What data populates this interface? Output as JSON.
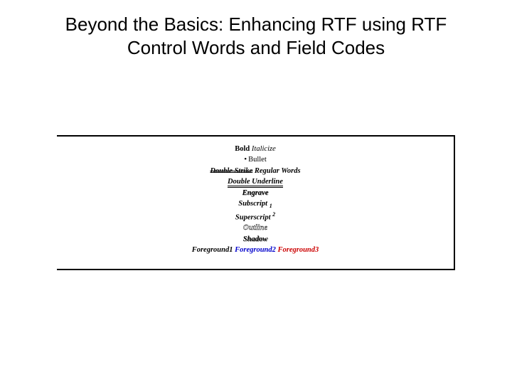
{
  "title": "Beyond the Basics: Enhancing RTF using RTF Control Words and Field Codes",
  "sample": {
    "bold": "Bold",
    "italicize": "Italicize",
    "bullet": "Bullet",
    "double_strike": "Double Strike",
    "regular_words": "Regular Words",
    "double_underline": "Double Underline",
    "engrave": "Engrave",
    "subscript_label": "Subscript",
    "subscript_value": "1",
    "superscript_label": "Superscript",
    "superscript_value": "2",
    "outline": "Outline",
    "shadow": "Shadow",
    "fg1": "Foreground1",
    "fg2": "Foreground2",
    "fg3": "Foreground3"
  }
}
